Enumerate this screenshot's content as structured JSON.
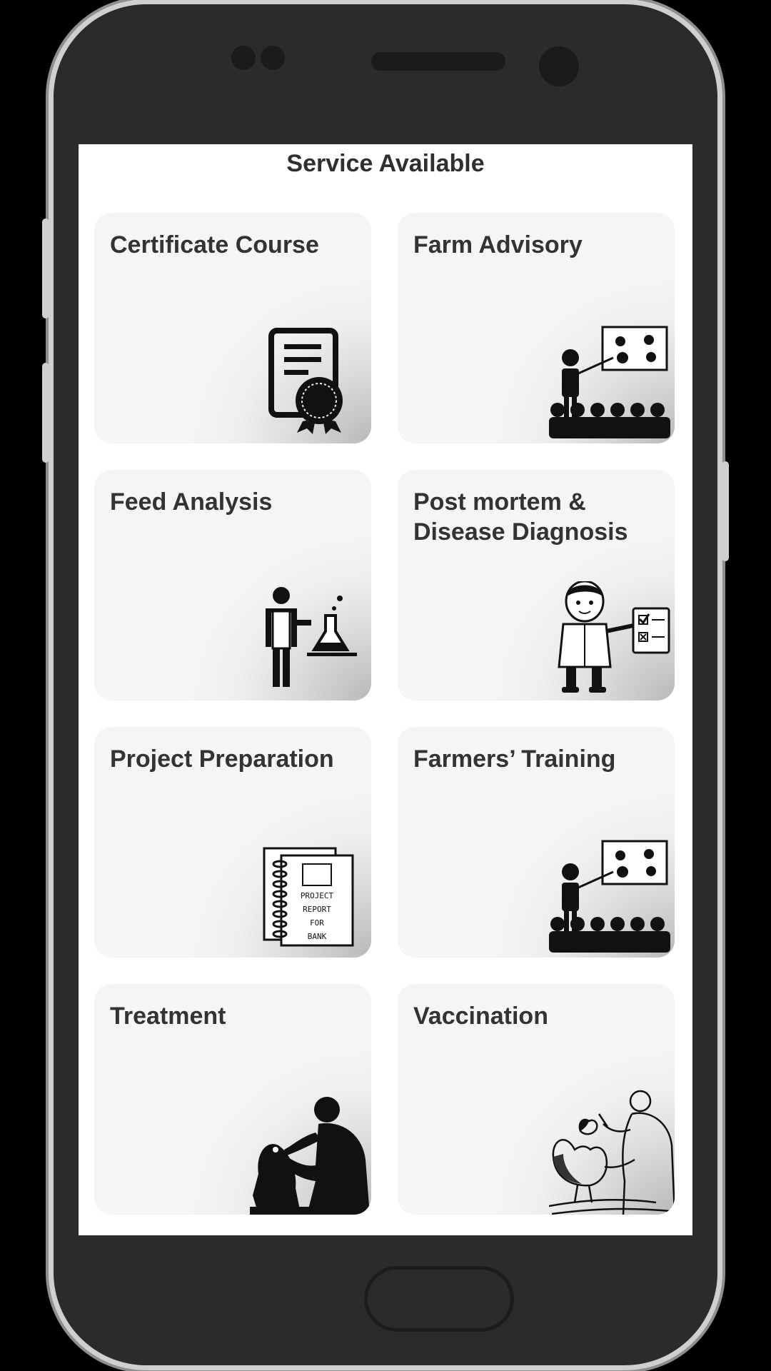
{
  "page": {
    "title": "Service Available"
  },
  "services": [
    {
      "title": "Certificate Course",
      "icon": "certificate-icon"
    },
    {
      "title": "Farm Advisory",
      "icon": "advisory-presentation-icon"
    },
    {
      "title": "Feed Analysis",
      "icon": "lab-analysis-icon"
    },
    {
      "title": "Post mortem & Disease Diagnosis",
      "icon": "doctor-checklist-icon"
    },
    {
      "title": "Project Preparation",
      "icon": "project-report-icon",
      "art_text": [
        "PROJECT",
        "REPORT",
        "FOR",
        "BANK"
      ]
    },
    {
      "title": "Farmers’ Training",
      "icon": "training-presentation-icon"
    },
    {
      "title": "Treatment",
      "icon": "treatment-icon"
    },
    {
      "title": "Vaccination",
      "icon": "vaccination-icon"
    }
  ],
  "colors": {
    "card_bg": "#f4f6f6",
    "phone_body": "#2b2b2b",
    "title_text": "#333333"
  }
}
